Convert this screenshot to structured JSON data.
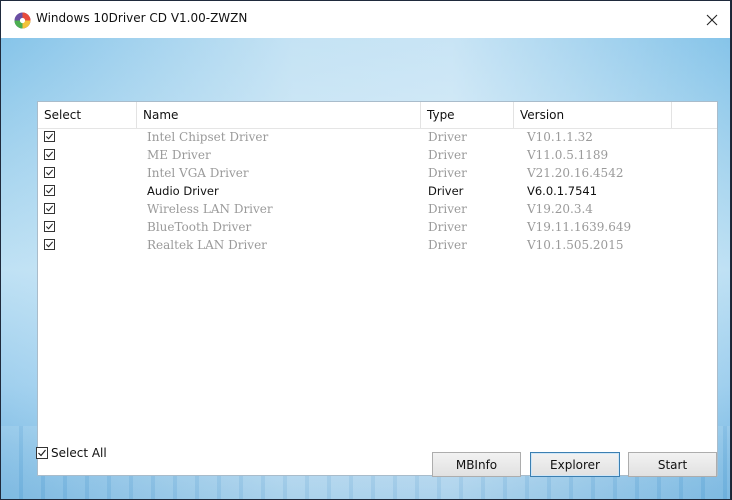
{
  "window": {
    "title": "Windows 10Driver CD V1.00-ZWZN",
    "icon": "app-logo-icon",
    "close_icon": "close-icon",
    "close_glyph": "✕"
  },
  "list": {
    "columns": {
      "select": "Select",
      "name": "Name",
      "type": "Type",
      "version": "Version"
    },
    "rows": [
      {
        "checked": true,
        "name": "Intel Chipset Driver",
        "type": "Driver",
        "version": "V10.1.1.32",
        "active": false
      },
      {
        "checked": true,
        "name": "ME Driver",
        "type": "Driver",
        "version": "V11.0.5.1189",
        "active": false
      },
      {
        "checked": true,
        "name": "Intel VGA Driver",
        "type": "Driver",
        "version": "V21.20.16.4542",
        "active": false
      },
      {
        "checked": true,
        "name": "Audio Driver",
        "type": "Driver",
        "version": "V6.0.1.7541",
        "active": true
      },
      {
        "checked": true,
        "name": "Wireless LAN Driver",
        "type": "Driver",
        "version": "V19.20.3.4",
        "active": false
      },
      {
        "checked": true,
        "name": "BlueTooth Driver",
        "type": "Driver",
        "version": "V19.11.1639.649",
        "active": false
      },
      {
        "checked": true,
        "name": "Realtek LAN Driver",
        "type": "Driver",
        "version": "V10.1.505.2015",
        "active": false
      }
    ]
  },
  "controls": {
    "select_all_label": "Select All",
    "select_all_checked": true,
    "mbinfo_label": "MBInfo",
    "explorer_label": "Explorer",
    "start_label": "Start"
  },
  "colors": {
    "inactive_text": "#9a9a9a",
    "active_text": "#111111",
    "focused_button_border": "#3c7fb1"
  }
}
